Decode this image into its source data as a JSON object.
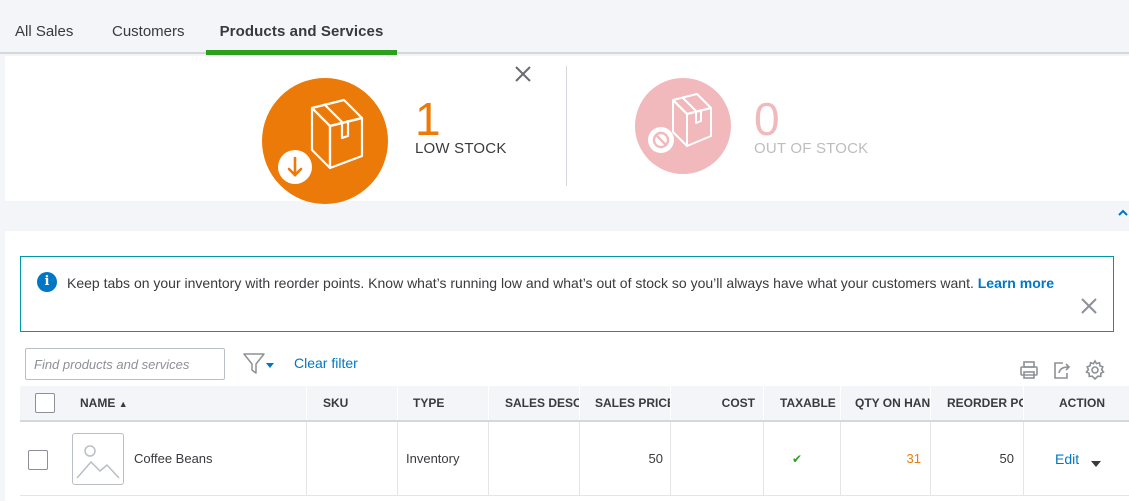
{
  "tabs": [
    {
      "label": "All Sales"
    },
    {
      "label": "Customers"
    },
    {
      "label": "Products and Services"
    }
  ],
  "stock": {
    "low": {
      "count": "1",
      "label": "LOW STOCK"
    },
    "out": {
      "count": "0",
      "label": "OUT OF STOCK"
    }
  },
  "info": {
    "text": "Keep tabs on your inventory with reorder points. Know what’s running low and what’s out of stock so you’ll always have what your customers want.",
    "link": "Learn more"
  },
  "search": {
    "placeholder": "Find products and services"
  },
  "clear_filter": "Clear filter",
  "table": {
    "columns": {
      "name": "NAME",
      "sku": "SKU",
      "type": "TYPE",
      "sales_desc": "SALES DESCRIPTION",
      "sales_price": "SALES PRICE",
      "cost": "COST",
      "taxable": "TAXABLE",
      "qty": "QTY ON HAND",
      "reorder": "REORDER POINT",
      "action": "ACTION"
    },
    "sort_indicator": "▲",
    "rows": [
      {
        "name": "Coffee Beans",
        "sku": "",
        "type": "Inventory",
        "sales_desc": "",
        "sales_price": "50",
        "cost": "",
        "taxable": "✔",
        "qty": "31",
        "reorder": "50",
        "action": "Edit"
      }
    ]
  },
  "colors": {
    "accent_green": "#2ca01c",
    "low_stock_orange": "#ec7a08",
    "out_stock_pink": "#f1b9bc",
    "link_blue": "#0077c5",
    "info_border": "#0097a7"
  },
  "icons": {
    "low_stock": "box-download-icon",
    "out_stock": "box-blocked-icon",
    "info": "info-icon",
    "filter": "funnel-icon",
    "print": "printer-icon",
    "export": "export-icon",
    "settings": "gear-icon"
  }
}
